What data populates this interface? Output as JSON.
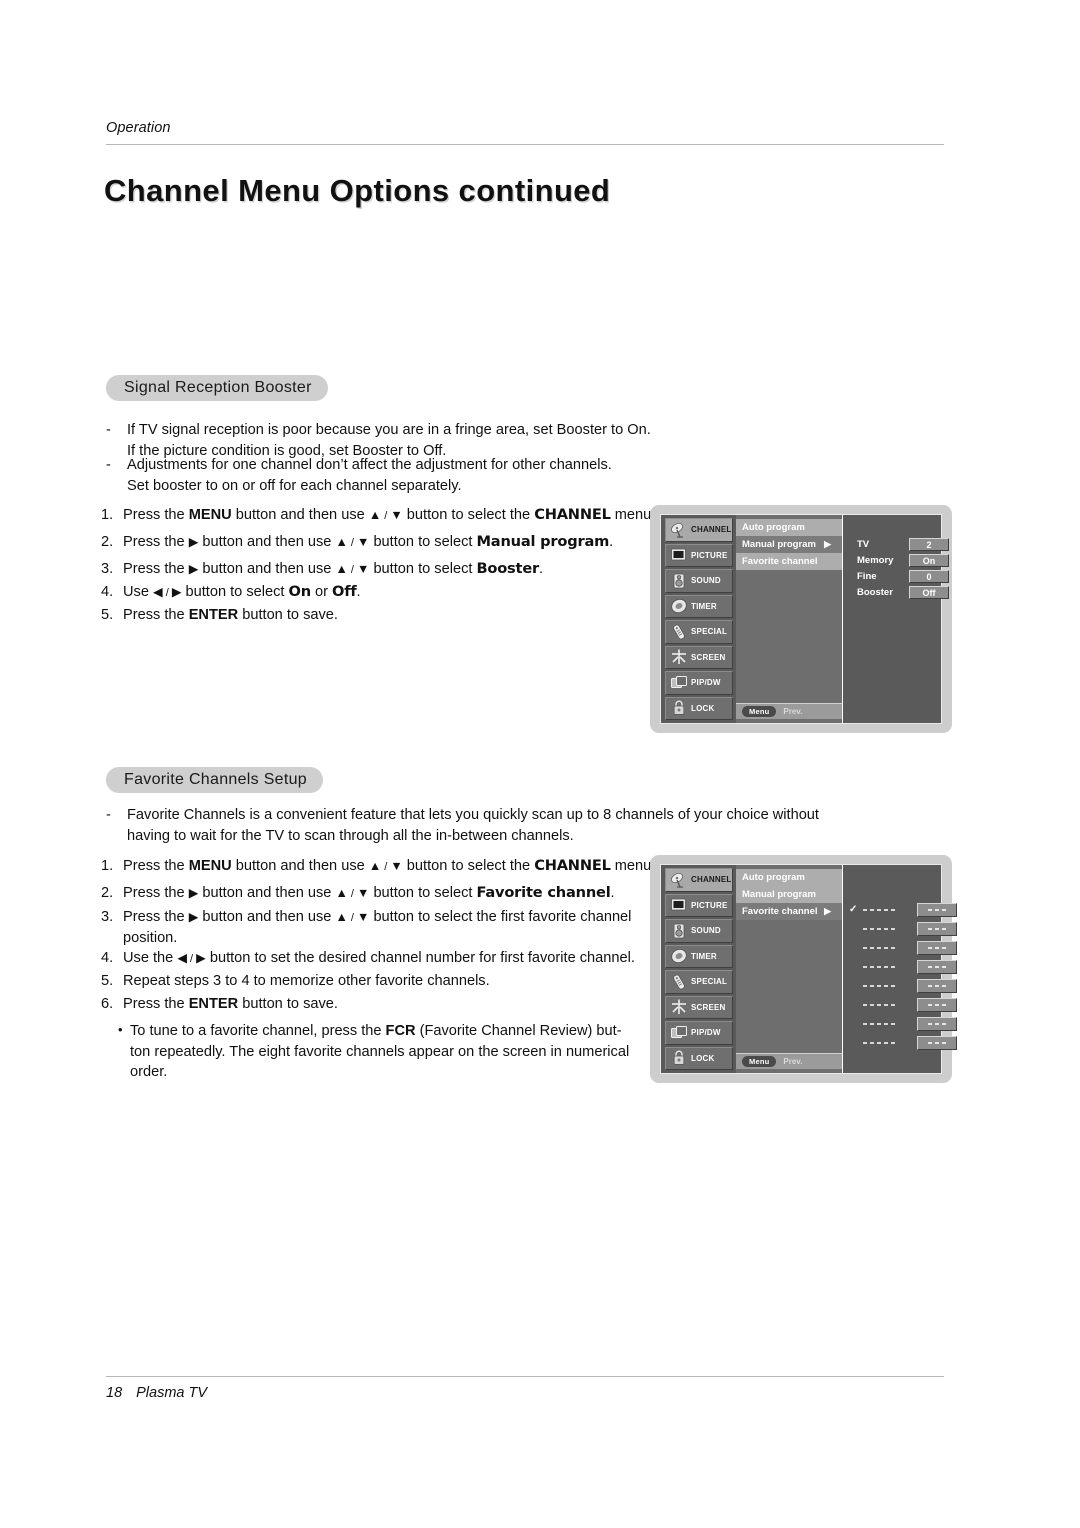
{
  "header": {
    "eyebrow": "Operation",
    "title": "Channel Menu Options continued"
  },
  "footer": {
    "page_number": "18",
    "product": "Plasma TV"
  },
  "sections": [
    {
      "id": "signal-reception-booster",
      "heading": "Signal Reception Booster",
      "notes": [
        "If TV signal reception is poor because you are in a fringe area, set Booster to On. If the picture condition is good, set Booster to Off.",
        "Adjustments for one channel don’t affect the adjustment for other channels. Set booster to on or off for each channel separately."
      ],
      "note_lines": [
        [
          "If TV signal reception is poor because you are in a fringe area, set Booster to On.",
          "If the picture condition is good, set Booster to Off."
        ],
        [
          "Adjustments for one channel don’t affect the adjustment for other channels.",
          "Set booster to on or off for each channel separately."
        ]
      ],
      "steps": [
        {
          "n": "1.",
          "parts": [
            "Press the ",
            "MENU",
            " button and then use ",
            "▲",
            " / ",
            "▼",
            " button to select the ",
            "CHANNEL",
            " menu."
          ]
        },
        {
          "n": "2.",
          "parts": [
            "Press the ",
            "▶",
            " button and then use ",
            "▲",
            " / ",
            "▼",
            " button to select ",
            "Manual program",
            "."
          ]
        },
        {
          "n": "3.",
          "parts": [
            "Press the ",
            "▶",
            " button and then use ",
            "▲",
            " / ",
            "▼",
            " button to select ",
            "Booster",
            "."
          ]
        },
        {
          "n": "4.",
          "parts": [
            "Use ",
            "◀",
            " / ",
            "▶",
            " button to select ",
            "On",
            " or ",
            "Off",
            "."
          ]
        },
        {
          "n": "5.",
          "parts": [
            "Press the ",
            "ENTER",
            " button to save."
          ]
        }
      ]
    },
    {
      "id": "favorite-channels-setup",
      "heading": "Favorite Channels Setup",
      "note_lines": [
        [
          "Favorite Channels is a convenient feature that lets you quickly scan up to 8 channels of your choice without",
          "having to wait for the TV to scan through all the in-between channels."
        ]
      ],
      "steps": [
        {
          "n": "1.",
          "parts": [
            "Press the ",
            "MENU",
            " button and then use ",
            "▲",
            " / ",
            "▼",
            " button to select the ",
            "CHANNEL",
            " menu."
          ]
        },
        {
          "n": "2.",
          "parts": [
            "Press the ",
            "▶",
            " button and then use ",
            "▲",
            " / ",
            "▼",
            " button to select ",
            "Favorite channel",
            "."
          ]
        },
        {
          "n": "3.",
          "parts": [
            "Press the ",
            "▶",
            " button and then use ",
            "▲",
            " / ",
            "▼",
            " button to select the first favorite channel position."
          ]
        },
        {
          "n": "4.",
          "parts": [
            "Use the ",
            "◀",
            " / ",
            "▶",
            " button to set the desired channel number for first favorite channel."
          ]
        },
        {
          "n": "5.",
          "parts": [
            "Repeat steps 3 to 4 to memorize other favorite channels."
          ]
        },
        {
          "n": "6.",
          "parts": [
            "Press the ",
            "ENTER",
            " button to save."
          ]
        }
      ],
      "bullet_lines": [
        "To tune to a favorite channel, press the ",
        "FCR",
        " (Favorite Channel Review) but-",
        "ton repeatedly. The eight favorite channels appear on the screen in numerical",
        "order."
      ]
    }
  ],
  "osd": {
    "nav_items": [
      {
        "label": "CHANNEL",
        "icon": "satellite-dish-icon"
      },
      {
        "label": "PICTURE",
        "icon": "tv-screen-icon"
      },
      {
        "label": "SOUND",
        "icon": "speaker-icon"
      },
      {
        "label": "TIMER",
        "icon": "clock-icon"
      },
      {
        "label": "SPECIAL",
        "icon": "remote-control-icon"
      },
      {
        "label": "SCREEN",
        "icon": "crosshair-icon"
      },
      {
        "label": "PIP/DW",
        "icon": "picture-in-picture-icon"
      },
      {
        "label": "LOCK",
        "icon": "padlock-icon"
      }
    ],
    "bottom_bar": {
      "menu_label": "Menu",
      "prev_label": "Prev."
    },
    "menu1": {
      "selected_nav": "CHANNEL",
      "list": [
        {
          "label": "Auto program",
          "state": "normal"
        },
        {
          "label": "Manual program",
          "state": "selected",
          "caret": "▶"
        },
        {
          "label": "Favorite channel",
          "state": "normal"
        }
      ],
      "values": [
        {
          "name": "TV",
          "value": "2"
        },
        {
          "name": "Memory",
          "value": "On"
        },
        {
          "name": "Fine",
          "value": "0"
        },
        {
          "name": "Booster",
          "value": "Off"
        }
      ]
    },
    "menu2": {
      "selected_nav": "CHANNEL",
      "list": [
        {
          "label": "Auto program",
          "state": "normal"
        },
        {
          "label": "Manual program",
          "state": "normal"
        },
        {
          "label": "Favorite channel",
          "state": "selected",
          "caret": "▶"
        }
      ],
      "favorites": [
        {
          "check": "✓",
          "name": "- - - - -",
          "value": "- - -"
        },
        {
          "check": "",
          "name": "- - - - -",
          "value": "- - -"
        },
        {
          "check": "",
          "name": "- - - - -",
          "value": "- - -"
        },
        {
          "check": "",
          "name": "- - - - -",
          "value": "- - -"
        },
        {
          "check": "",
          "name": "- - - - -",
          "value": "- - -"
        },
        {
          "check": "",
          "name": "- - - - -",
          "value": "- - -"
        },
        {
          "check": "",
          "name": "- - - - -",
          "value": "- - -"
        },
        {
          "check": "",
          "name": "- - - - -",
          "value": "- - -"
        }
      ]
    }
  },
  "colors": {
    "pill_bg": "#cfcfcf",
    "rule": "#b8b8b8",
    "osd_frame": "#cdcdcd",
    "osd_panel": "#5a5a5a",
    "osd_list": "#adadad",
    "osd_list_selected": "#7b7b7b"
  }
}
